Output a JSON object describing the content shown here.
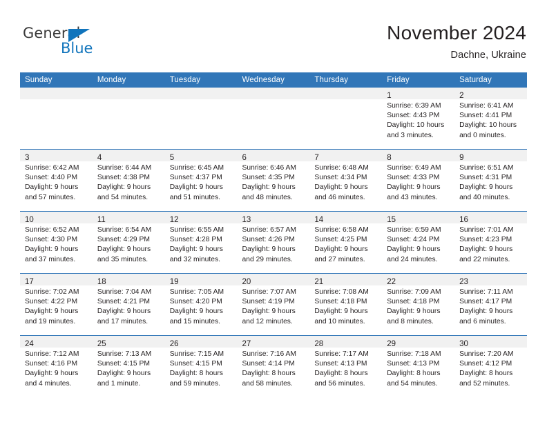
{
  "brand": {
    "name_part1": "General",
    "name_part2": "Blue",
    "color_blue": "#1074bc",
    "triangle_icon": "triangle-icon"
  },
  "header": {
    "month_title": "November 2024",
    "location": "Dachne, Ukraine"
  },
  "colors": {
    "header_blue": "#3176b8",
    "daynum_band": "#f1f1f1",
    "text": "#231f20"
  },
  "weekday_headers": [
    "Sunday",
    "Monday",
    "Tuesday",
    "Wednesday",
    "Thursday",
    "Friday",
    "Saturday"
  ],
  "weeks": [
    [
      {
        "day": "",
        "empty": true,
        "sunrise": "",
        "sunset": "",
        "daylight_1": "",
        "daylight_2": ""
      },
      {
        "day": "",
        "empty": true,
        "sunrise": "",
        "sunset": "",
        "daylight_1": "",
        "daylight_2": ""
      },
      {
        "day": "",
        "empty": true,
        "sunrise": "",
        "sunset": "",
        "daylight_1": "",
        "daylight_2": ""
      },
      {
        "day": "",
        "empty": true,
        "sunrise": "",
        "sunset": "",
        "daylight_1": "",
        "daylight_2": ""
      },
      {
        "day": "",
        "empty": true,
        "sunrise": "",
        "sunset": "",
        "daylight_1": "",
        "daylight_2": ""
      },
      {
        "day": "1",
        "empty": false,
        "sunrise": "Sunrise: 6:39 AM",
        "sunset": "Sunset: 4:43 PM",
        "daylight_1": "Daylight: 10 hours",
        "daylight_2": "and 3 minutes."
      },
      {
        "day": "2",
        "empty": false,
        "sunrise": "Sunrise: 6:41 AM",
        "sunset": "Sunset: 4:41 PM",
        "daylight_1": "Daylight: 10 hours",
        "daylight_2": "and 0 minutes."
      }
    ],
    [
      {
        "day": "3",
        "empty": false,
        "sunrise": "Sunrise: 6:42 AM",
        "sunset": "Sunset: 4:40 PM",
        "daylight_1": "Daylight: 9 hours",
        "daylight_2": "and 57 minutes."
      },
      {
        "day": "4",
        "empty": false,
        "sunrise": "Sunrise: 6:44 AM",
        "sunset": "Sunset: 4:38 PM",
        "daylight_1": "Daylight: 9 hours",
        "daylight_2": "and 54 minutes."
      },
      {
        "day": "5",
        "empty": false,
        "sunrise": "Sunrise: 6:45 AM",
        "sunset": "Sunset: 4:37 PM",
        "daylight_1": "Daylight: 9 hours",
        "daylight_2": "and 51 minutes."
      },
      {
        "day": "6",
        "empty": false,
        "sunrise": "Sunrise: 6:46 AM",
        "sunset": "Sunset: 4:35 PM",
        "daylight_1": "Daylight: 9 hours",
        "daylight_2": "and 48 minutes."
      },
      {
        "day": "7",
        "empty": false,
        "sunrise": "Sunrise: 6:48 AM",
        "sunset": "Sunset: 4:34 PM",
        "daylight_1": "Daylight: 9 hours",
        "daylight_2": "and 46 minutes."
      },
      {
        "day": "8",
        "empty": false,
        "sunrise": "Sunrise: 6:49 AM",
        "sunset": "Sunset: 4:33 PM",
        "daylight_1": "Daylight: 9 hours",
        "daylight_2": "and 43 minutes."
      },
      {
        "day": "9",
        "empty": false,
        "sunrise": "Sunrise: 6:51 AM",
        "sunset": "Sunset: 4:31 PM",
        "daylight_1": "Daylight: 9 hours",
        "daylight_2": "and 40 minutes."
      }
    ],
    [
      {
        "day": "10",
        "empty": false,
        "sunrise": "Sunrise: 6:52 AM",
        "sunset": "Sunset: 4:30 PM",
        "daylight_1": "Daylight: 9 hours",
        "daylight_2": "and 37 minutes."
      },
      {
        "day": "11",
        "empty": false,
        "sunrise": "Sunrise: 6:54 AM",
        "sunset": "Sunset: 4:29 PM",
        "daylight_1": "Daylight: 9 hours",
        "daylight_2": "and 35 minutes."
      },
      {
        "day": "12",
        "empty": false,
        "sunrise": "Sunrise: 6:55 AM",
        "sunset": "Sunset: 4:28 PM",
        "daylight_1": "Daylight: 9 hours",
        "daylight_2": "and 32 minutes."
      },
      {
        "day": "13",
        "empty": false,
        "sunrise": "Sunrise: 6:57 AM",
        "sunset": "Sunset: 4:26 PM",
        "daylight_1": "Daylight: 9 hours",
        "daylight_2": "and 29 minutes."
      },
      {
        "day": "14",
        "empty": false,
        "sunrise": "Sunrise: 6:58 AM",
        "sunset": "Sunset: 4:25 PM",
        "daylight_1": "Daylight: 9 hours",
        "daylight_2": "and 27 minutes."
      },
      {
        "day": "15",
        "empty": false,
        "sunrise": "Sunrise: 6:59 AM",
        "sunset": "Sunset: 4:24 PM",
        "daylight_1": "Daylight: 9 hours",
        "daylight_2": "and 24 minutes."
      },
      {
        "day": "16",
        "empty": false,
        "sunrise": "Sunrise: 7:01 AM",
        "sunset": "Sunset: 4:23 PM",
        "daylight_1": "Daylight: 9 hours",
        "daylight_2": "and 22 minutes."
      }
    ],
    [
      {
        "day": "17",
        "empty": false,
        "sunrise": "Sunrise: 7:02 AM",
        "sunset": "Sunset: 4:22 PM",
        "daylight_1": "Daylight: 9 hours",
        "daylight_2": "and 19 minutes."
      },
      {
        "day": "18",
        "empty": false,
        "sunrise": "Sunrise: 7:04 AM",
        "sunset": "Sunset: 4:21 PM",
        "daylight_1": "Daylight: 9 hours",
        "daylight_2": "and 17 minutes."
      },
      {
        "day": "19",
        "empty": false,
        "sunrise": "Sunrise: 7:05 AM",
        "sunset": "Sunset: 4:20 PM",
        "daylight_1": "Daylight: 9 hours",
        "daylight_2": "and 15 minutes."
      },
      {
        "day": "20",
        "empty": false,
        "sunrise": "Sunrise: 7:07 AM",
        "sunset": "Sunset: 4:19 PM",
        "daylight_1": "Daylight: 9 hours",
        "daylight_2": "and 12 minutes."
      },
      {
        "day": "21",
        "empty": false,
        "sunrise": "Sunrise: 7:08 AM",
        "sunset": "Sunset: 4:18 PM",
        "daylight_1": "Daylight: 9 hours",
        "daylight_2": "and 10 minutes."
      },
      {
        "day": "22",
        "empty": false,
        "sunrise": "Sunrise: 7:09 AM",
        "sunset": "Sunset: 4:18 PM",
        "daylight_1": "Daylight: 9 hours",
        "daylight_2": "and 8 minutes."
      },
      {
        "day": "23",
        "empty": false,
        "sunrise": "Sunrise: 7:11 AM",
        "sunset": "Sunset: 4:17 PM",
        "daylight_1": "Daylight: 9 hours",
        "daylight_2": "and 6 minutes."
      }
    ],
    [
      {
        "day": "24",
        "empty": false,
        "sunrise": "Sunrise: 7:12 AM",
        "sunset": "Sunset: 4:16 PM",
        "daylight_1": "Daylight: 9 hours",
        "daylight_2": "and 4 minutes."
      },
      {
        "day": "25",
        "empty": false,
        "sunrise": "Sunrise: 7:13 AM",
        "sunset": "Sunset: 4:15 PM",
        "daylight_1": "Daylight: 9 hours",
        "daylight_2": "and 1 minute."
      },
      {
        "day": "26",
        "empty": false,
        "sunrise": "Sunrise: 7:15 AM",
        "sunset": "Sunset: 4:15 PM",
        "daylight_1": "Daylight: 8 hours",
        "daylight_2": "and 59 minutes."
      },
      {
        "day": "27",
        "empty": false,
        "sunrise": "Sunrise: 7:16 AM",
        "sunset": "Sunset: 4:14 PM",
        "daylight_1": "Daylight: 8 hours",
        "daylight_2": "and 58 minutes."
      },
      {
        "day": "28",
        "empty": false,
        "sunrise": "Sunrise: 7:17 AM",
        "sunset": "Sunset: 4:13 PM",
        "daylight_1": "Daylight: 8 hours",
        "daylight_2": "and 56 minutes."
      },
      {
        "day": "29",
        "empty": false,
        "sunrise": "Sunrise: 7:18 AM",
        "sunset": "Sunset: 4:13 PM",
        "daylight_1": "Daylight: 8 hours",
        "daylight_2": "and 54 minutes."
      },
      {
        "day": "30",
        "empty": false,
        "sunrise": "Sunrise: 7:20 AM",
        "sunset": "Sunset: 4:12 PM",
        "daylight_1": "Daylight: 8 hours",
        "daylight_2": "and 52 minutes."
      }
    ]
  ]
}
